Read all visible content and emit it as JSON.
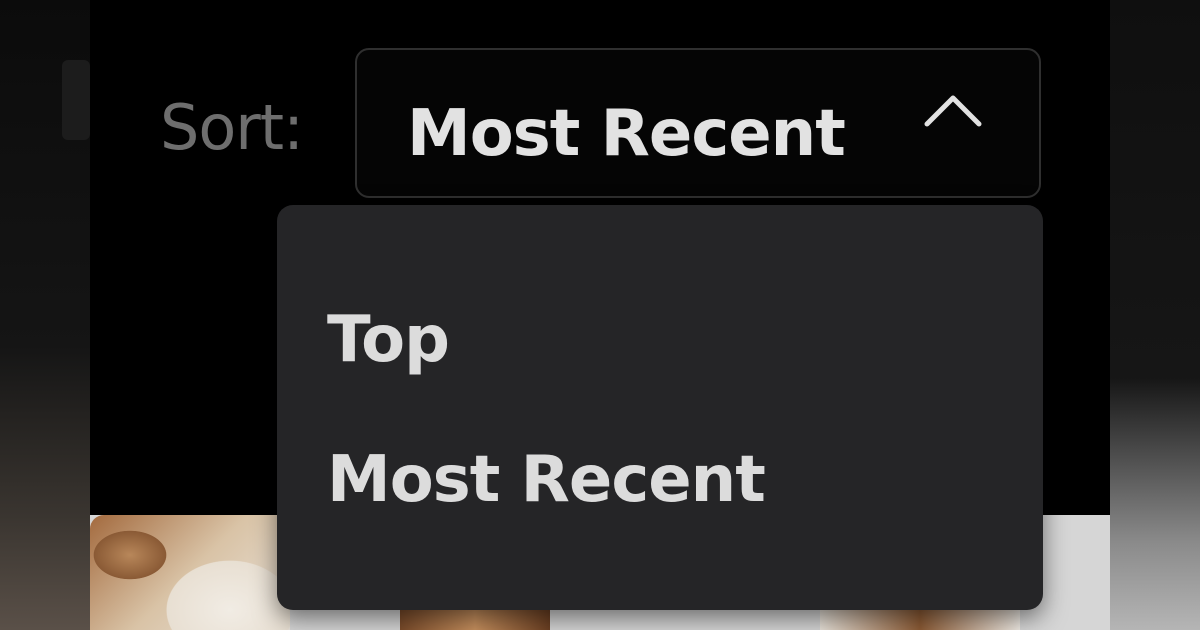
{
  "sort": {
    "label": "Sort:",
    "selected_value": "Most Recent",
    "expanded_icon": "chevron-up-icon",
    "options": [
      {
        "label": "Top"
      },
      {
        "label": "Most Recent"
      }
    ]
  },
  "colors": {
    "background": "#000000",
    "menu_background": "#252527",
    "text_primary": "#e2e2e2",
    "text_muted": "#6e6e6e"
  }
}
